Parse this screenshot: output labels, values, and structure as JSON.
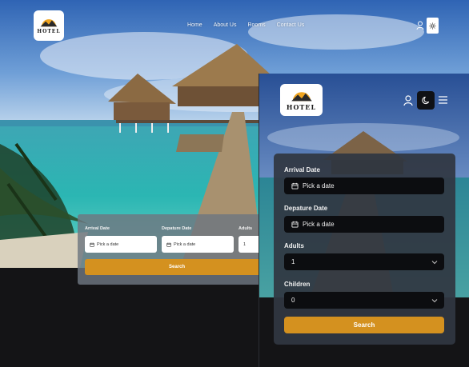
{
  "brand": {
    "logo_text": "HOTEL"
  },
  "nav": {
    "items": [
      {
        "label": "Home"
      },
      {
        "label": "About Us"
      },
      {
        "label": "Rooms"
      },
      {
        "label": "Contact Us"
      }
    ]
  },
  "search_form": {
    "arrival_label": "Arrival Date",
    "departure_label": "Depature Date",
    "adults_label": "Adults",
    "children_label": "Children",
    "date_placeholder": "Pick a date",
    "adults_value": "1",
    "children_value": "0",
    "search_button": "Search"
  },
  "icons": {
    "user": "user-icon",
    "theme_light": "sun-icon",
    "theme_dark": "moon-icon",
    "menu": "hamburger-menu-icon",
    "calendar": "calendar-icon",
    "dropdown": "chevron-down-icon"
  },
  "colors": {
    "accent": "#d4911f",
    "dark_bg": "#141416",
    "panel": "#303742",
    "field_dark": "#0c0d10"
  }
}
